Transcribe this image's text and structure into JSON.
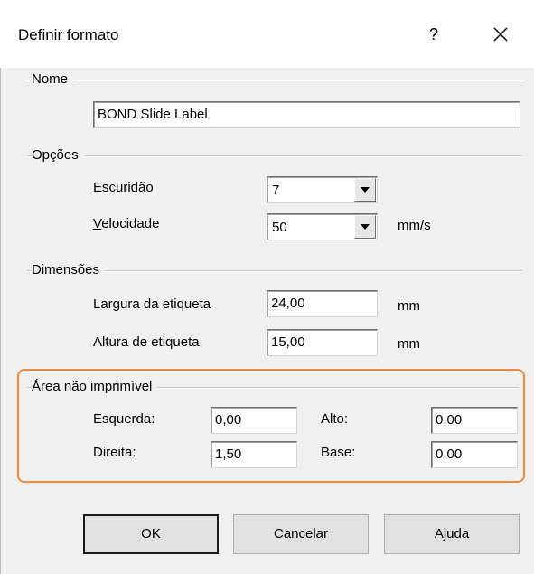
{
  "window": {
    "title": "Definir formato",
    "help_glyph": "?",
    "close_icon": "close-icon"
  },
  "nome": {
    "group_label": "Nome",
    "value": "BOND Slide Label"
  },
  "opcoes": {
    "group_label": "Opções",
    "escuridao": {
      "label_accel": "E",
      "label_rest": "scuridão",
      "value": "7"
    },
    "velocidade": {
      "label_accel": "V",
      "label_rest": "elocidade",
      "value": "50",
      "unit": "mm/s"
    }
  },
  "dimensoes": {
    "group_label": "Dimensões",
    "largura": {
      "label": "Largura da etiqueta",
      "value": "24,00",
      "unit": "mm"
    },
    "altura": {
      "label": "Altura de etiqueta",
      "value": "15,00",
      "unit": "mm"
    }
  },
  "area": {
    "group_label": "Área não imprimível",
    "esquerda": {
      "label": "Esquerda:",
      "value": "0,00"
    },
    "direita": {
      "label": "Direita:",
      "value": "1,50"
    },
    "alto": {
      "label": "Alto:",
      "value": "0,00"
    },
    "base": {
      "label": "Base:",
      "value": "0,00"
    },
    "highlight_color": "#f0883e"
  },
  "buttons": {
    "ok": "OK",
    "cancel": "Cancelar",
    "help": "Ajuda"
  }
}
